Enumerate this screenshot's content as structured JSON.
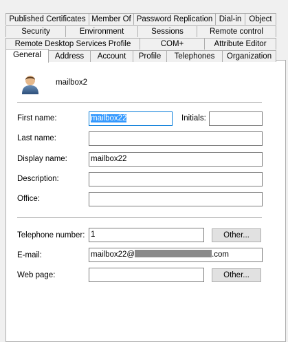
{
  "tabs": {
    "row1": [
      "Published Certificates",
      "Member Of",
      "Password Replication",
      "Dial-in",
      "Object"
    ],
    "row2": [
      "Security",
      "Environment",
      "Sessions",
      "Remote control"
    ],
    "row3": [
      "Remote Desktop Services Profile",
      "COM+",
      "Attribute Editor"
    ],
    "row4": [
      "General",
      "Address",
      "Account",
      "Profile",
      "Telephones",
      "Organization"
    ]
  },
  "general": {
    "object_name": "mailbox2",
    "icon": "user-icon",
    "fields": {
      "first_name": {
        "label": "First name:",
        "value": "mailbox22"
      },
      "initials": {
        "label": "Initials:",
        "value": ""
      },
      "last_name": {
        "label": "Last name:",
        "value": ""
      },
      "display_name": {
        "label": "Display name:",
        "value": "mailbox22"
      },
      "description": {
        "label": "Description:",
        "value": ""
      },
      "office": {
        "label": "Office:",
        "value": ""
      },
      "telephone": {
        "label": "Telephone number:",
        "value": "1"
      },
      "email": {
        "label": "E-mail:",
        "value_prefix": "mailbox22@",
        "value_suffix": ".com"
      },
      "web_page": {
        "label": "Web page:",
        "value": ""
      }
    },
    "buttons": {
      "other_label": "Other..."
    }
  },
  "colors": {
    "selection": "#3399ff",
    "panel_bg": "#ffffff",
    "window_bg": "#f0f0f0"
  }
}
